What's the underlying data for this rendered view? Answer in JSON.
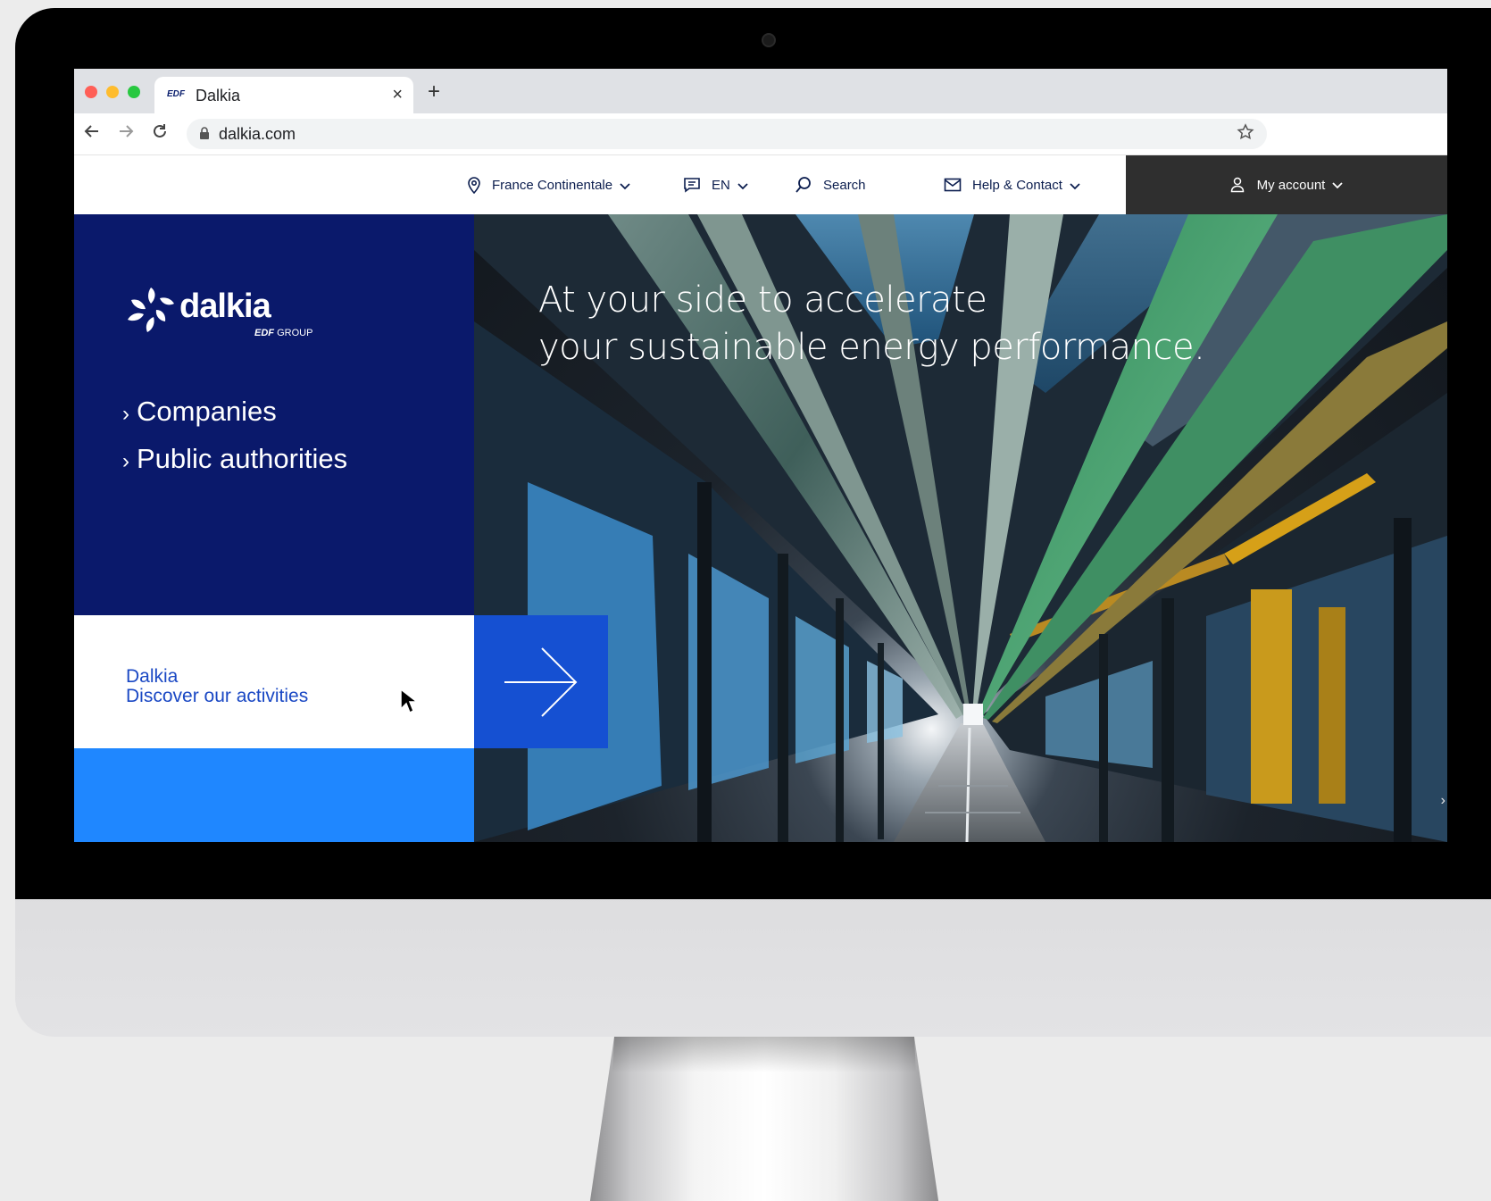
{
  "browser": {
    "tab_favicon": "EDF",
    "tab_title": "Dalkia",
    "tab_close": "×",
    "new_tab": "+",
    "url": "dalkia.com"
  },
  "header": {
    "region": "France Continentale",
    "language": "EN",
    "search": "Search",
    "help": "Help & Contact",
    "account": "My account"
  },
  "sidebar": {
    "logo_word": "dalkia",
    "logo_group_brand": "EDF",
    "logo_group_label": "GROUP",
    "links": [
      {
        "label": "Companies"
      },
      {
        "label": "Public authorities"
      }
    ]
  },
  "hero": {
    "title_line1": "At your side to accelerate",
    "title_line2": "your sustainable energy performance."
  },
  "discover": {
    "line1": "Dalkia",
    "line2": "Discover our activities"
  },
  "colors": {
    "navy": "#0a196b",
    "blue": "#1550d2",
    "light_blue": "#1f87ff",
    "link_blue": "#1a48c4",
    "dark_header": "#2f2f2f"
  },
  "icons": [
    "location-pin-icon",
    "chat-icon",
    "search-icon",
    "mail-icon",
    "user-icon",
    "chevron-down-icon",
    "arrow-right-icon",
    "lock-icon",
    "star-icon",
    "mouse-cursor-icon"
  ]
}
